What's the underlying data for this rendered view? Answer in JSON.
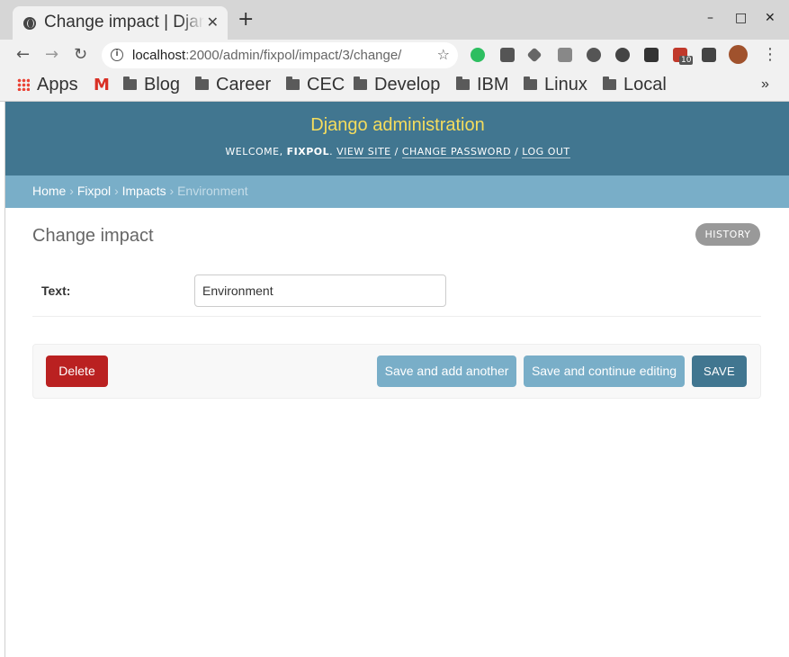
{
  "browser": {
    "tab_title": "Change impact | Django site admin",
    "tab_close": "✕",
    "new_tab": "+",
    "window_controls": {
      "minimize": "–",
      "maximize": "□",
      "close": "✕"
    },
    "url_host": "localhost",
    "url_path": ":2000/admin/fixpol/impact/3/change/",
    "extension_badge": "10",
    "bookmarks": [
      {
        "label": "Apps",
        "icon": "apps-grid-icon"
      },
      {
        "label": "",
        "icon": "gmail-icon"
      },
      {
        "label": "Blog",
        "icon": "folder-icon"
      },
      {
        "label": "Career",
        "icon": "folder-icon"
      },
      {
        "label": "CEC",
        "icon": "folder-icon"
      },
      {
        "label": "Develop",
        "icon": "folder-icon"
      },
      {
        "label": "IBM",
        "icon": "folder-icon"
      },
      {
        "label": "Linux",
        "icon": "folder-icon"
      },
      {
        "label": "Local",
        "icon": "folder-icon"
      }
    ],
    "overflow": "»"
  },
  "admin": {
    "site_name": "Django administration",
    "welcome": "WELCOME, ",
    "username": "FIXPOL",
    "view_site": "VIEW SITE",
    "change_password": "CHANGE PASSWORD",
    "log_out": "LOG OUT",
    "breadcrumbs": {
      "home": "Home",
      "app": "Fixpol",
      "model": "Impacts",
      "current": "Environment"
    },
    "page_title": "Change impact",
    "history_label": "HISTORY",
    "field_label": "Text:",
    "field_value": "Environment",
    "buttons": {
      "delete": "Delete",
      "save_add": "Save and add another",
      "save_continue": "Save and continue editing",
      "save": "SAVE"
    }
  },
  "colors": {
    "header": "#417690",
    "breadcrumbs": "#79aec8",
    "brand_text": "#f5dd5d",
    "delete": "#ba2121"
  }
}
